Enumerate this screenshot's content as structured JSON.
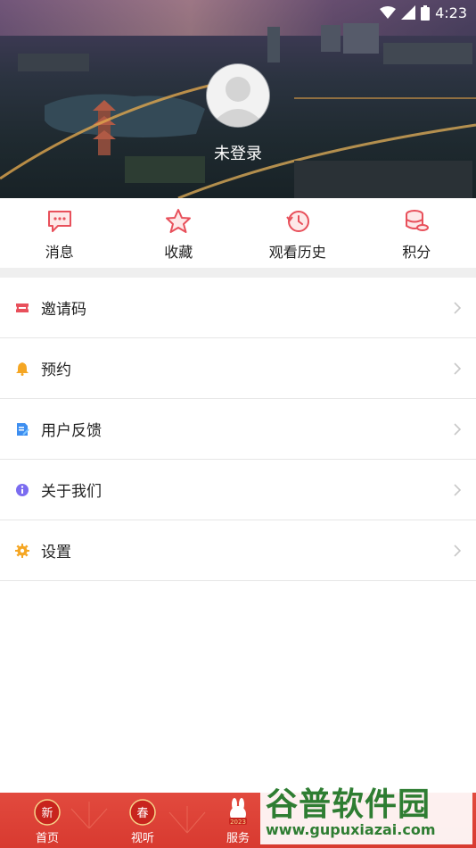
{
  "status_bar": {
    "time": "4:23"
  },
  "profile": {
    "username": "未登录"
  },
  "quick_actions": [
    {
      "label": "消息",
      "icon": "message-icon"
    },
    {
      "label": "收藏",
      "icon": "star-icon"
    },
    {
      "label": "观看历史",
      "icon": "history-icon"
    },
    {
      "label": "积分",
      "icon": "coins-icon"
    }
  ],
  "menu": [
    {
      "label": "邀请码",
      "icon": "ticket-icon",
      "color": "#e8505b"
    },
    {
      "label": "预约",
      "icon": "bell-icon",
      "color": "#f5a623"
    },
    {
      "label": "用户反馈",
      "icon": "feedback-icon",
      "color": "#3d8ef0"
    },
    {
      "label": "关于我们",
      "icon": "info-icon",
      "color": "#7b6cf0"
    },
    {
      "label": "设置",
      "icon": "gear-icon",
      "color": "#f5a623"
    }
  ],
  "tabbar": {
    "tabs": [
      {
        "label": "首页",
        "badge": "新",
        "icon": "home-icon"
      },
      {
        "label": "视听",
        "badge": "春",
        "icon": "media-icon"
      },
      {
        "label": "服务",
        "badge": "2023",
        "icon": "rabbit-icon"
      }
    ]
  },
  "watermark": {
    "text": "谷普软件园",
    "url": "www.gupuxiazai.com"
  },
  "colors": {
    "accent": "#e24a3e",
    "icon_red": "#e8505b"
  }
}
